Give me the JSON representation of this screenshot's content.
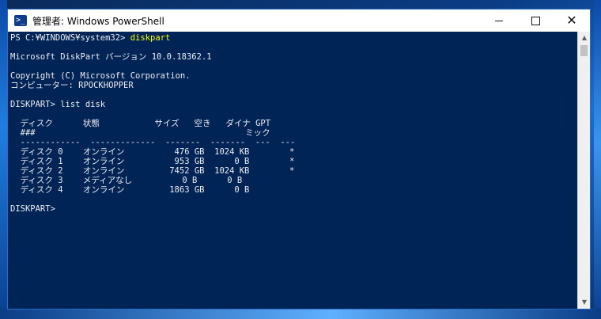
{
  "window": {
    "title": "管理者: Windows PowerShell",
    "icon": "powershell-icon"
  },
  "console": {
    "lines": [
      {
        "prompt": "PS C:¥WINDOWS¥system32> ",
        "command": "diskpart"
      },
      {
        "text": ""
      },
      {
        "text": "Microsoft DiskPart バージョン 10.0.18362.1"
      },
      {
        "text": ""
      },
      {
        "text": "Copyright (C) Microsoft Corporation."
      },
      {
        "text": "コンピューター: RPOCKHOPPER"
      },
      {
        "text": ""
      },
      {
        "text": "DISKPART> list disk"
      },
      {
        "text": ""
      },
      {
        "text": "  ディスク      状態           サイズ   空き   ダイナ GPT"
      },
      {
        "text": "  ###                                          ミック"
      },
      {
        "text": "  ------------  -------------  -------  -------  ---  ---"
      },
      {
        "text": "  ディスク 0    オンライン          476 GB  1024 KB        *"
      },
      {
        "text": "  ディスク 1    オンライン          953 GB      0 B        *"
      },
      {
        "text": "  ディスク 2    オンライン         7452 GB  1024 KB        *"
      },
      {
        "text": "  ディスク 3    メディアなし          0 B      0 B"
      },
      {
        "text": "  ディスク 4    オンライン         1863 GB      0 B"
      },
      {
        "text": ""
      },
      {
        "text": "DISKPART> "
      }
    ]
  },
  "colors": {
    "console_bg": "#012456",
    "console_fg": "#eeedf0",
    "command_highlight": "#ffff00"
  }
}
